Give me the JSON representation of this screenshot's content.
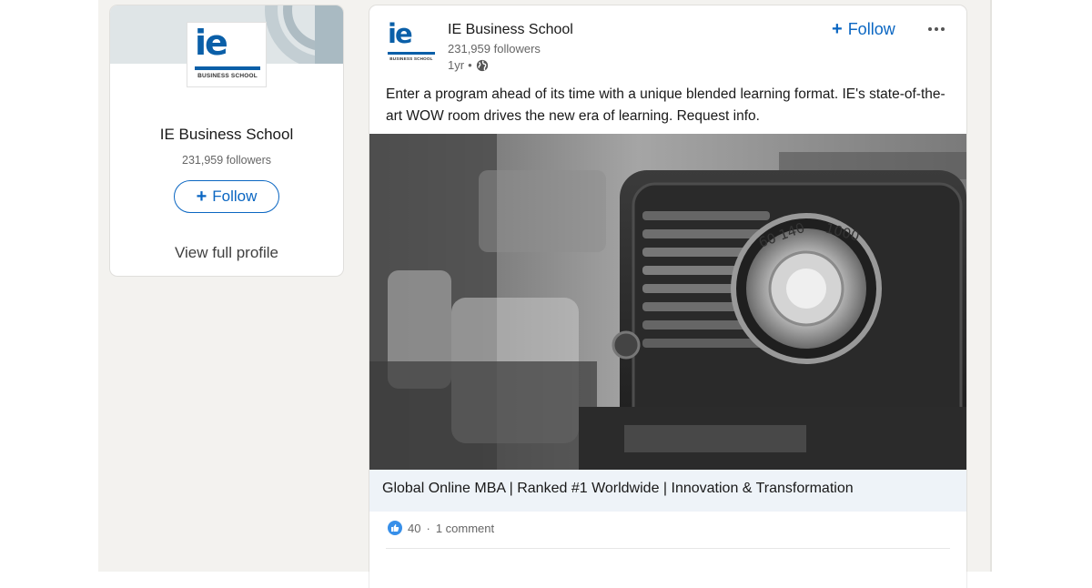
{
  "profile_card": {
    "logo": {
      "mark": "ie",
      "subtitle": "BUSINESS SCHOOL"
    },
    "name": "IE Business School",
    "followers": "231,959 followers",
    "follow_label": "Follow",
    "view_profile_label": "View full profile"
  },
  "post": {
    "company": "IE Business School",
    "followers": "231,959 followers",
    "age": "1yr",
    "separator": "•",
    "follow_label": "Follow",
    "text": "Enter a program ahead of its time with a unique blended learning format. IE's state-of-the-art WOW room drives the new era of learning. Request info.",
    "caption": "Global Online MBA | Ranked #1 Worldwide | Innovation & Transformation",
    "reactions_count": "40",
    "comments": "1 comment",
    "social_separator": "·"
  },
  "image": {
    "dial_text_1": "60 140",
    "dial_text_2": "1000"
  },
  "icons": {
    "globe": "globe-icon",
    "plus": "plus-icon",
    "more": "more-icon",
    "like": "like-icon"
  },
  "colors": {
    "accent": "#0a66c2",
    "logo_blue": "#0a5fa8",
    "caption_bg": "#eef3f8",
    "page_bg": "#f3f2ef",
    "like_blue": "#378fe9"
  }
}
